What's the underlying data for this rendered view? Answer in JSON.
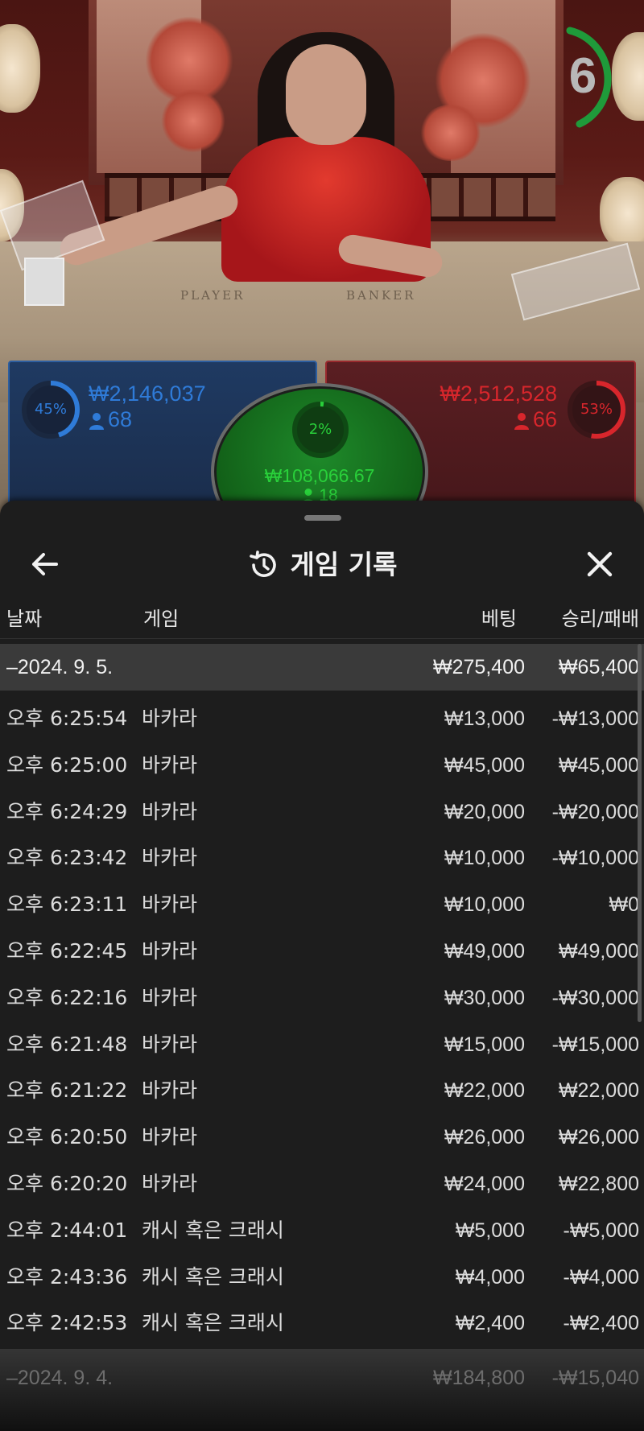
{
  "video": {
    "table_left_label": "PLAYER",
    "table_right_label": "BANKER",
    "countdown": "6"
  },
  "bets": {
    "player": {
      "percent": "45%",
      "percent_value": 45,
      "amount": "₩2,146,037",
      "players": "68",
      "color": "#2f7bd8"
    },
    "banker": {
      "percent": "53%",
      "percent_value": 53,
      "amount": "₩2,512,528",
      "players": "66",
      "color": "#d8262c"
    },
    "tie": {
      "percent": "2%",
      "percent_value": 2,
      "amount": "₩108,066.67",
      "players": "18",
      "color": "#29d03a"
    }
  },
  "sheet": {
    "title": "게임 기록",
    "back_icon": "arrow-left-icon",
    "history_icon": "history-icon",
    "close_icon": "close-icon",
    "columns": {
      "date": "날짜",
      "game": "게임",
      "bet": "베팅",
      "win_loss": "승리/패배"
    },
    "days": [
      {
        "date": "–2024. 9. 5.",
        "bet_total": "₩275,400",
        "win_loss_total": "₩65,400",
        "rows": [
          {
            "time": "오후 6:25:54",
            "game": "바카라",
            "bet": "₩13,000",
            "win_loss": "-₩13,000"
          },
          {
            "time": "오후 6:25:00",
            "game": "바카라",
            "bet": "₩45,000",
            "win_loss": "₩45,000"
          },
          {
            "time": "오후 6:24:29",
            "game": "바카라",
            "bet": "₩20,000",
            "win_loss": "-₩20,000"
          },
          {
            "time": "오후 6:23:42",
            "game": "바카라",
            "bet": "₩10,000",
            "win_loss": "-₩10,000"
          },
          {
            "time": "오후 6:23:11",
            "game": "바카라",
            "bet": "₩10,000",
            "win_loss": "₩0"
          },
          {
            "time": "오후 6:22:45",
            "game": "바카라",
            "bet": "₩49,000",
            "win_loss": "₩49,000"
          },
          {
            "time": "오후 6:22:16",
            "game": "바카라",
            "bet": "₩30,000",
            "win_loss": "-₩30,000"
          },
          {
            "time": "오후 6:21:48",
            "game": "바카라",
            "bet": "₩15,000",
            "win_loss": "-₩15,000"
          },
          {
            "time": "오후 6:21:22",
            "game": "바카라",
            "bet": "₩22,000",
            "win_loss": "₩22,000"
          },
          {
            "time": "오후 6:20:50",
            "game": "바카라",
            "bet": "₩26,000",
            "win_loss": "₩26,000"
          },
          {
            "time": "오후 6:20:20",
            "game": "바카라",
            "bet": "₩24,000",
            "win_loss": "₩22,800"
          },
          {
            "time": "오후 2:44:01",
            "game": "캐시 혹은 크래시",
            "bet": "₩5,000",
            "win_loss": "-₩5,000"
          },
          {
            "time": "오후 2:43:36",
            "game": "캐시 혹은 크래시",
            "bet": "₩4,000",
            "win_loss": "-₩4,000"
          },
          {
            "time": "오후 2:42:53",
            "game": "캐시 혹은 크래시",
            "bet": "₩2,400",
            "win_loss": "-₩2,400"
          }
        ]
      },
      {
        "date": "–2024. 9. 4.",
        "bet_total": "₩184,800",
        "win_loss_total": "-₩15,040"
      }
    ]
  }
}
